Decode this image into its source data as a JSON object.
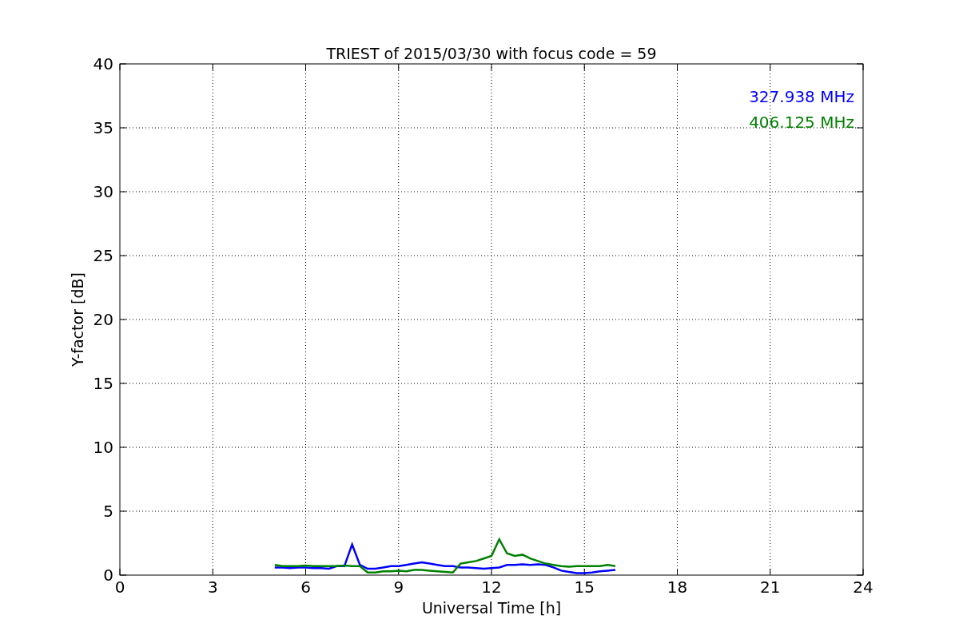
{
  "chart_data": {
    "type": "line",
    "title": "TRIEST of 2015/03/30 with focus code = 59",
    "xlabel": "Universal Time [h]",
    "ylabel": "Y-factor [dB]",
    "x": [
      5,
      5.25,
      5.5,
      5.75,
      6,
      6.25,
      6.5,
      6.75,
      7,
      7.25,
      7.5,
      7.75,
      8,
      8.25,
      8.5,
      8.75,
      9,
      9.25,
      9.5,
      9.75,
      10,
      10.25,
      10.5,
      10.75,
      11,
      11.25,
      11.5,
      11.75,
      12,
      12.25,
      12.5,
      12.75,
      13,
      13.25,
      13.5,
      13.75,
      14,
      14.25,
      14.5,
      14.75,
      15,
      15.25,
      15.5,
      15.75,
      16
    ],
    "series": [
      {
        "name": "327.938 MHz",
        "color": "#0000ff",
        "values": [
          0.6,
          0.6,
          0.55,
          0.6,
          0.6,
          0.55,
          0.55,
          0.5,
          0.7,
          0.7,
          2.4,
          0.8,
          0.5,
          0.5,
          0.6,
          0.7,
          0.7,
          0.8,
          0.9,
          1.0,
          0.9,
          0.8,
          0.7,
          0.7,
          0.6,
          0.6,
          0.55,
          0.5,
          0.55,
          0.6,
          0.8,
          0.8,
          0.85,
          0.8,
          0.85,
          0.8,
          0.6,
          0.35,
          0.25,
          0.15,
          0.15,
          0.2,
          0.3,
          0.35,
          0.4
        ]
      },
      {
        "name": "406.125 MHz",
        "color": "#008000",
        "values": [
          0.8,
          0.7,
          0.7,
          0.7,
          0.75,
          0.7,
          0.7,
          0.7,
          0.7,
          0.75,
          0.7,
          0.7,
          0.2,
          0.2,
          0.3,
          0.3,
          0.35,
          0.3,
          0.4,
          0.4,
          0.35,
          0.3,
          0.25,
          0.2,
          0.9,
          1.0,
          1.1,
          1.3,
          1.5,
          2.8,
          1.7,
          1.5,
          1.6,
          1.3,
          1.1,
          0.9,
          0.8,
          0.7,
          0.65,
          0.7,
          0.7,
          0.7,
          0.7,
          0.8,
          0.7
        ]
      }
    ],
    "xlim": [
      0,
      24
    ],
    "ylim": [
      0,
      40
    ],
    "xticks": [
      0,
      3,
      6,
      9,
      12,
      15,
      18,
      21,
      24
    ],
    "yticks": [
      0,
      5,
      10,
      15,
      20,
      25,
      30,
      35,
      40
    ],
    "grid": true
  }
}
